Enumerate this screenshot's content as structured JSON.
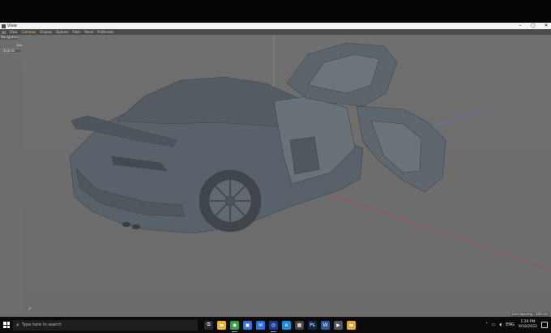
{
  "window": {
    "title": "View",
    "controls": [
      "–",
      "▢",
      "✕"
    ]
  },
  "menu": {
    "items": [
      "View",
      "Cameras",
      "Display",
      "Options",
      "Filter",
      "Panel",
      "ProRender"
    ],
    "active_index": 1
  },
  "left_panel": {
    "tab": "Navigation",
    "label": "Tabs",
    "objects_button": "Objects"
  },
  "viewport": {
    "status": "Grid Spacing : 100 cm",
    "axis_glyph": "↗"
  },
  "taskbar": {
    "search_placeholder": "Type here to search",
    "search_icon": "search-icon",
    "apps": [
      {
        "name": "task-view-icon",
        "glyph": "⧉",
        "color": "#2a2a2a",
        "running": false
      },
      {
        "name": "file-explorer-icon",
        "glyph": "▬",
        "color": "#e8b33a",
        "running": false
      },
      {
        "name": "chrome-icon",
        "glyph": "◉",
        "color": "#3c9a4d",
        "running": true
      },
      {
        "name": "store-icon",
        "glyph": "▣",
        "color": "#3a6fd1",
        "running": false
      },
      {
        "name": "mail-icon",
        "glyph": "✉",
        "color": "#2f6fd6",
        "running": false
      },
      {
        "name": "cinema4d-icon",
        "glyph": "◎",
        "color": "#1d3b8a",
        "running": true
      },
      {
        "name": "edge-icon",
        "glyph": "e",
        "color": "#1f8ad8",
        "running": false
      },
      {
        "name": "app-icon",
        "glyph": "▦",
        "color": "#444",
        "running": false
      },
      {
        "name": "photoshop-icon",
        "glyph": "Ps",
        "color": "#0b2a4a",
        "running": false
      },
      {
        "name": "word-icon",
        "glyph": "W",
        "color": "#2b5797",
        "running": false
      },
      {
        "name": "media-icon",
        "glyph": "▶",
        "color": "#555",
        "running": false
      },
      {
        "name": "folder-icon",
        "glyph": "▬",
        "color": "#d9a93a",
        "running": false
      }
    ],
    "tray": {
      "language": "ENG",
      "time": "1:29 PM",
      "date": "9/18/2022"
    }
  },
  "colors": {
    "viewport_bg": "#6d6d6d",
    "car": "#5a626a",
    "axis_x": "#b24a4a",
    "axis_y": "#6ab36a",
    "axis_z": "#5a6fc8"
  }
}
